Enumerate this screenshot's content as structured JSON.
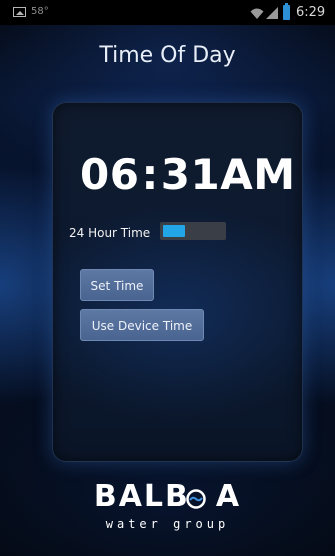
{
  "status_bar": {
    "temperature": "58°",
    "clock": "6:29",
    "icons": [
      "gallery-icon",
      "wifi-icon",
      "signal-icon",
      "battery-icon"
    ]
  },
  "screen": {
    "title": "Time Of Day"
  },
  "time": {
    "hours": "06",
    "separator": ":",
    "minutes": "31",
    "meridiem": "AM"
  },
  "hour_format": {
    "label": "24 Hour Time",
    "enabled": false
  },
  "buttons": {
    "set_time": "Set Time",
    "use_device_time": "Use Device Time"
  },
  "logo": {
    "word": "BALB",
    "word_end": "A",
    "tagline": "water group"
  },
  "colors": {
    "accent": "#23a6e8",
    "button": "#5470a0",
    "background": "#06112a"
  }
}
